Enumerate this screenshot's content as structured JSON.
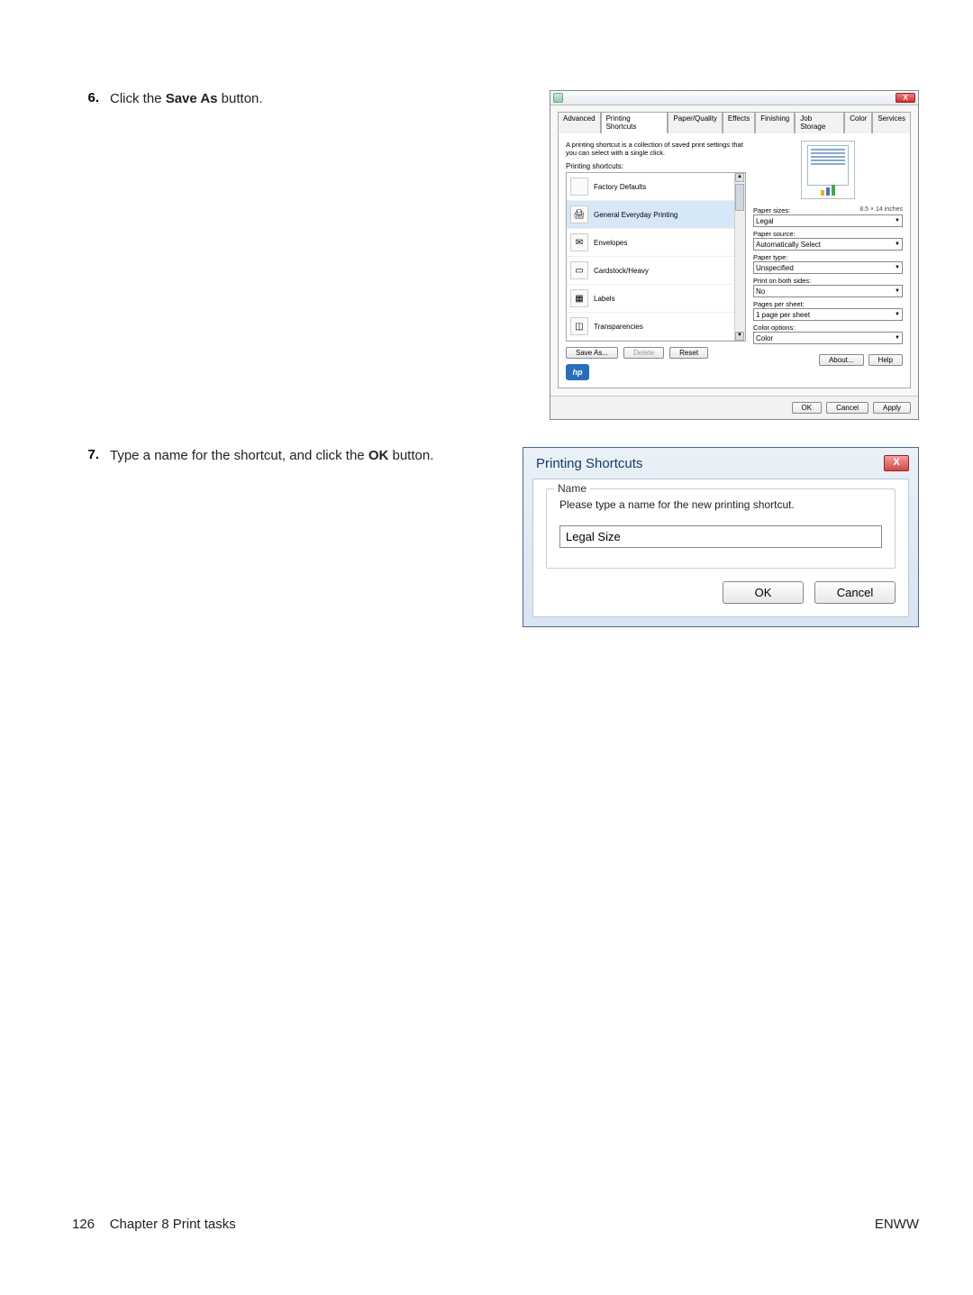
{
  "steps": {
    "s6": {
      "num": "6.",
      "text_before": "Click the ",
      "bold": "Save As",
      "text_after": " button."
    },
    "s7": {
      "num": "7.",
      "text_before": "Type a name for the shortcut, and click the ",
      "bold": "OK",
      "text_after": " button."
    }
  },
  "dlg1": {
    "close_x": "X",
    "tabs": {
      "advanced": "Advanced",
      "shortcuts": "Printing Shortcuts",
      "paperquality": "Paper/Quality",
      "effects": "Effects",
      "finishing": "Finishing",
      "jobstorage": "Job Storage",
      "color": "Color",
      "services": "Services"
    },
    "desc": "A printing shortcut is a collection of saved print settings that you can select with a single click.",
    "list_label": "Printing shortcuts:",
    "shortcuts": {
      "factory": "Factory Defaults",
      "everyday": "General Everyday Printing",
      "envelopes": "Envelopes",
      "cardstock": "Cardstock/Heavy",
      "labels": "Labels",
      "transparencies": "Transparencies"
    },
    "btns": {
      "save_as": "Save As...",
      "delete": "Delete",
      "reset": "Reset"
    },
    "fields": {
      "paper_sizes_label": "Paper sizes:",
      "paper_sizes_dim": "8.5 × 14 inches",
      "paper_sizes_value": "Legal",
      "paper_source_label": "Paper source:",
      "paper_source_value": "Automatically Select",
      "paper_type_label": "Paper type:",
      "paper_type_value": "Unspecified",
      "both_sides_label": "Print on both sides:",
      "both_sides_value": "No",
      "pages_label": "Pages per sheet:",
      "pages_value": "1 page per sheet",
      "color_opt_label": "Color options:",
      "color_opt_value": "Color"
    },
    "hp_logo": "hp",
    "about": "About...",
    "help": "Help",
    "ok": "OK",
    "cancel": "Cancel",
    "apply": "Apply"
  },
  "dlg2": {
    "title": "Printing Shortcuts",
    "close_x": "X",
    "group_label": "Name",
    "prompt": "Please type a name for the new printing shortcut.",
    "input_value": "Legal Size",
    "ok": "OK",
    "cancel": "Cancel"
  },
  "footer": {
    "page_num": "126",
    "chapter": "Chapter 8   Print tasks",
    "brand": "ENWW"
  }
}
